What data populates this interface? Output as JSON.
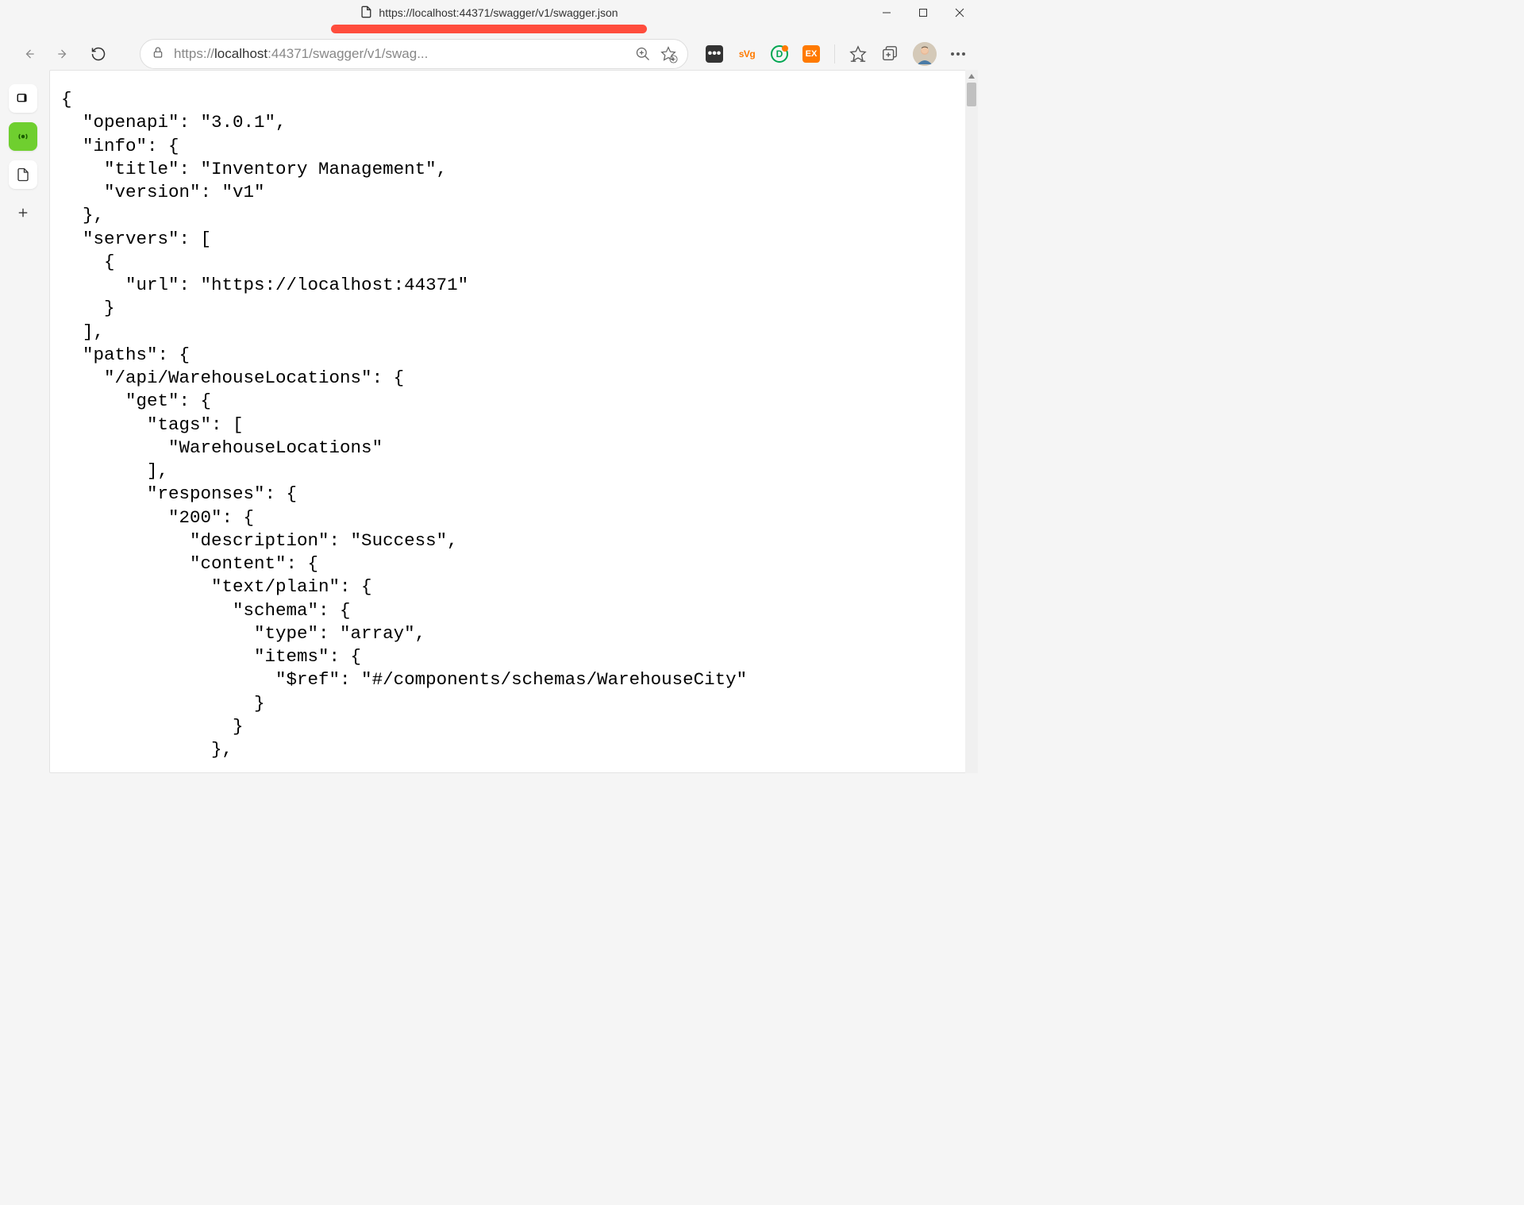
{
  "window": {
    "title": "https://localhost:44371/swagger/v1/swagger.json"
  },
  "address": {
    "prefix": "https://",
    "host": "localhost",
    "port_path": ":44371/swagger/v1/swag...",
    "full_display": "https://localhost:44371/swagger/v1/swag..."
  },
  "extensions": {
    "svg_label": "sVg",
    "d_label": "D",
    "ex_label": "EX"
  },
  "json_lines": [
    "{",
    "  \"openapi\": \"3.0.1\",",
    "  \"info\": {",
    "    \"title\": \"Inventory Management\",",
    "    \"version\": \"v1\"",
    "  },",
    "  \"servers\": [",
    "    {",
    "      \"url\": \"https://localhost:44371\"",
    "    }",
    "  ],",
    "  \"paths\": {",
    "    \"/api/WarehouseLocations\": {",
    "      \"get\": {",
    "        \"tags\": [",
    "          \"WarehouseLocations\"",
    "        ],",
    "        \"responses\": {",
    "          \"200\": {",
    "            \"description\": \"Success\",",
    "            \"content\": {",
    "              \"text/plain\": {",
    "                \"schema\": {",
    "                  \"type\": \"array\",",
    "                  \"items\": {",
    "                    \"$ref\": \"#/components/schemas/WarehouseCity\"",
    "                  }",
    "                }",
    "              },"
  ]
}
